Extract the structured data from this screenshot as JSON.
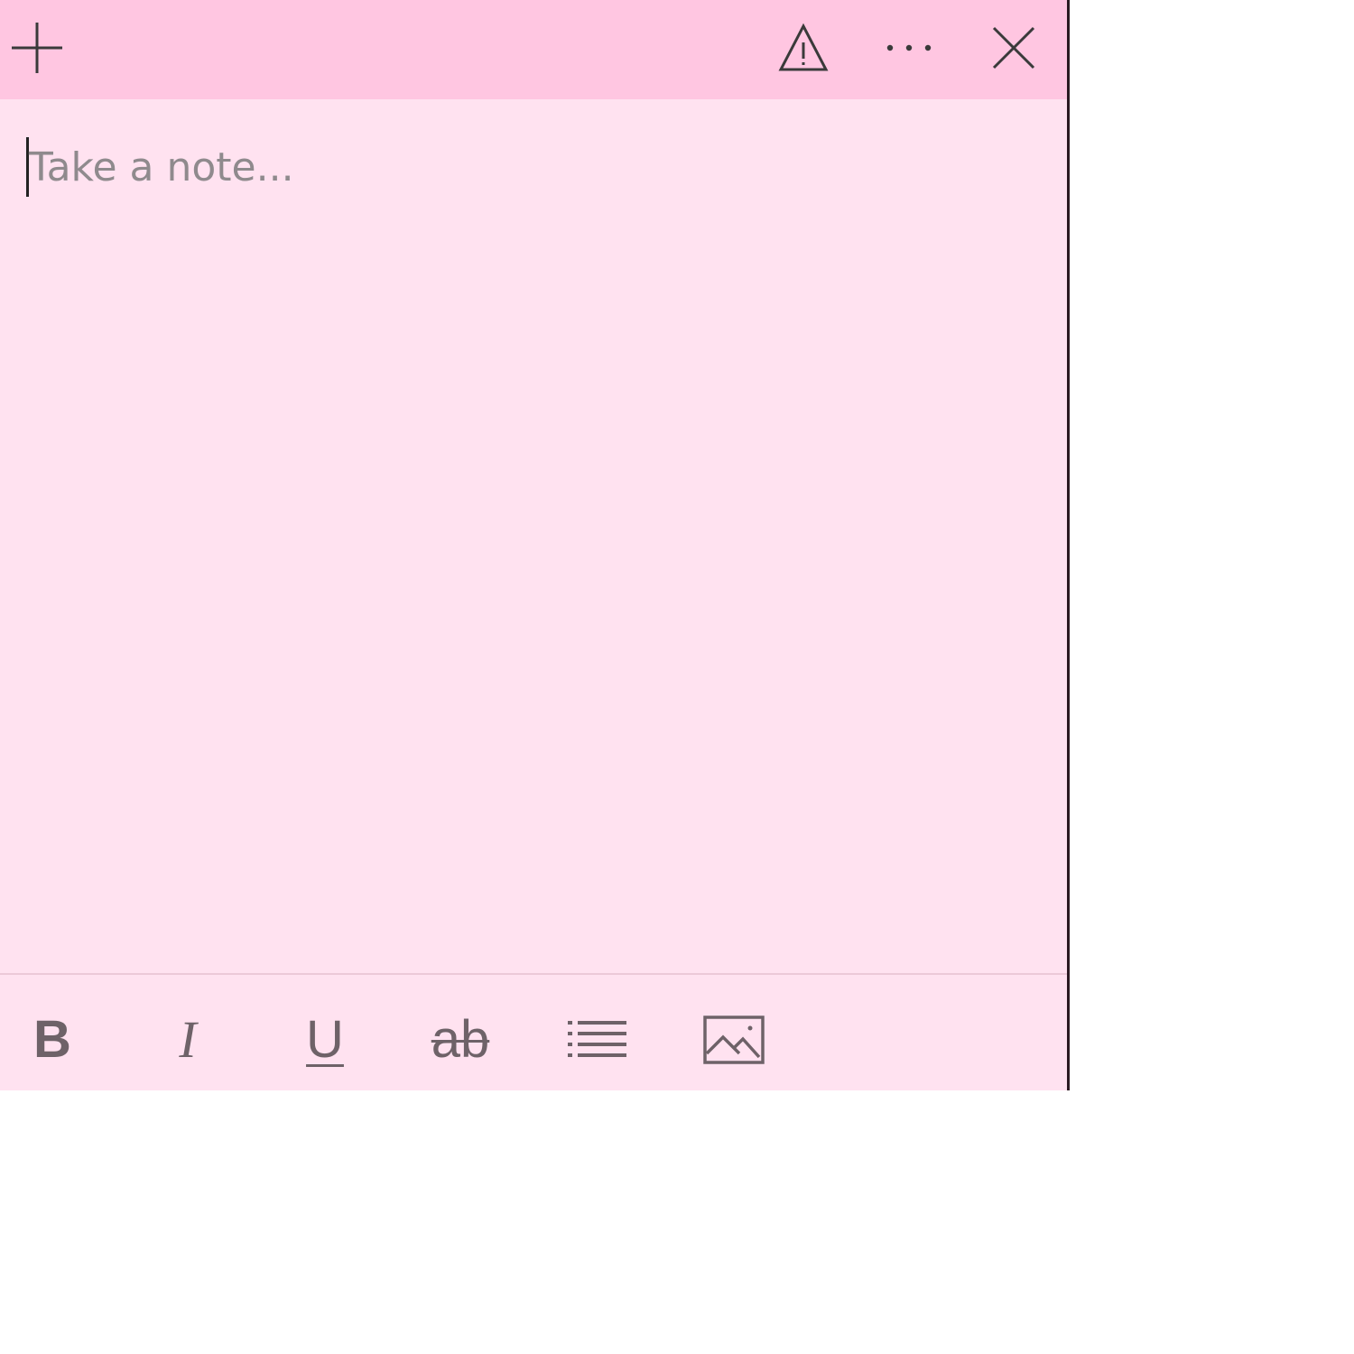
{
  "window": {
    "background_color": "#ffe2f0",
    "titlebar_color": "#ffc6e1",
    "border_color": "#2b1a22"
  },
  "titlebar": {
    "buttons": [
      {
        "icon": "plus-icon"
      },
      {
        "icon": "warning-icon"
      },
      {
        "icon": "more-icon"
      },
      {
        "icon": "close-icon"
      }
    ]
  },
  "editor": {
    "placeholder": "Take a note...",
    "value": ""
  },
  "toolbar": {
    "bold_label": "B",
    "italic_label": "I",
    "underline_label": "U",
    "strikethrough_label": "ab",
    "list_icon": "bullet-list-icon",
    "image_icon": "image-icon",
    "icon_color": "#6e6268"
  }
}
